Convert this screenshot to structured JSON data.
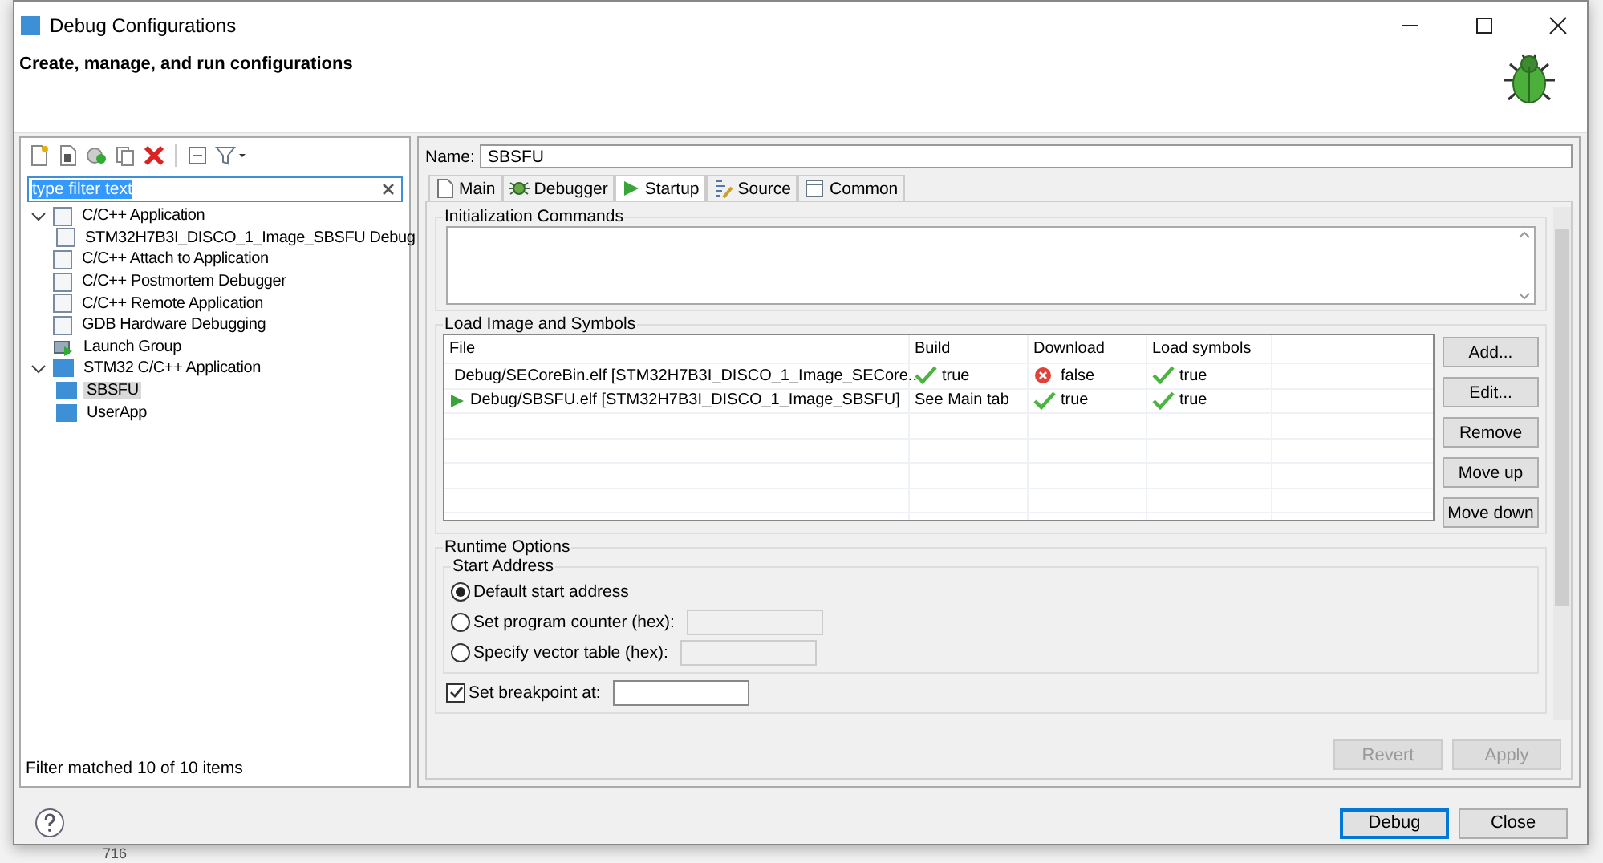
{
  "window": {
    "title": "Debug Configurations",
    "heading": "Create, manage, and run configurations"
  },
  "background": {
    "line_number": "716"
  },
  "filter": {
    "value": "type filter text"
  },
  "tree": [
    {
      "label": "C/C++ Application",
      "kind": "c",
      "expanded": true,
      "selected": false,
      "children": [
        {
          "label": "STM32H7B3I_DISCO_1_Image_SBSFU Debug",
          "kind": "c",
          "selected": false
        }
      ]
    },
    {
      "label": "C/C++ Attach to Application",
      "kind": "c",
      "selected": false
    },
    {
      "label": "C/C++ Postmortem Debugger",
      "kind": "c",
      "selected": false
    },
    {
      "label": "C/C++ Remote Application",
      "kind": "c",
      "selected": false
    },
    {
      "label": "GDB Hardware Debugging",
      "kind": "c",
      "selected": false
    },
    {
      "label": "Launch Group",
      "kind": "launch",
      "selected": false
    },
    {
      "label": "STM32 C/C++ Application",
      "kind": "ide",
      "expanded": true,
      "selected": false,
      "children": [
        {
          "label": "SBSFU",
          "kind": "ide",
          "selected": true
        },
        {
          "label": "UserApp",
          "kind": "ide",
          "selected": false
        }
      ]
    }
  ],
  "filter_status": "Filter matched 10 of 10 items",
  "name": {
    "label": "Name:",
    "value": "SBSFU"
  },
  "tabs": [
    {
      "label": "Main",
      "kind": "page",
      "selected": false
    },
    {
      "label": "Debugger",
      "kind": "bug",
      "selected": false
    },
    {
      "label": "Startup",
      "kind": "play",
      "selected": true
    },
    {
      "label": "Source",
      "kind": "source",
      "selected": false
    },
    {
      "label": "Common",
      "kind": "window",
      "selected": false
    }
  ],
  "init_commands": {
    "title": "Initialization Commands"
  },
  "load_image": {
    "title": "Load Image and Symbols",
    "columns": [
      "File",
      "Build",
      "Download",
      "Load symbols"
    ],
    "rows": [
      {
        "active": false,
        "cells": [
          {
            "text": "Debug/SECoreBin.elf [STM32H7B3I_DISCO_1_Image_SECore..."
          },
          {
            "text": "true",
            "ok": true
          },
          {
            "text": "false",
            "ok": false
          },
          {
            "text": "true",
            "ok": true
          }
        ]
      },
      {
        "active": true,
        "cells": [
          {
            "text": "Debug/SBSFU.elf [STM32H7B3I_DISCO_1_Image_SBSFU]"
          },
          {
            "text": "See Main tab"
          },
          {
            "text": "true",
            "ok": true
          },
          {
            "text": "true",
            "ok": true
          }
        ]
      }
    ],
    "buttons": [
      "Add...",
      "Edit...",
      "Remove",
      "Move up",
      "Move down"
    ]
  },
  "runtime": {
    "title": "Runtime Options",
    "start_address": {
      "title": "Start Address",
      "options": [
        {
          "label": "Default start address",
          "selected": true,
          "field": false
        },
        {
          "label": "Set program counter (hex):",
          "selected": false,
          "field": true
        },
        {
          "label": "Specify vector table (hex):",
          "selected": false,
          "field": true
        }
      ]
    },
    "breakpoint": {
      "label": "Set breakpoint at:",
      "checked": true
    }
  },
  "panel_buttons": [
    {
      "label": "Revert",
      "disabled": true
    },
    {
      "label": "Apply",
      "disabled": true
    }
  ],
  "dialog_buttons": [
    {
      "label": "Debug",
      "default": true
    },
    {
      "label": "Close",
      "default": false
    }
  ]
}
